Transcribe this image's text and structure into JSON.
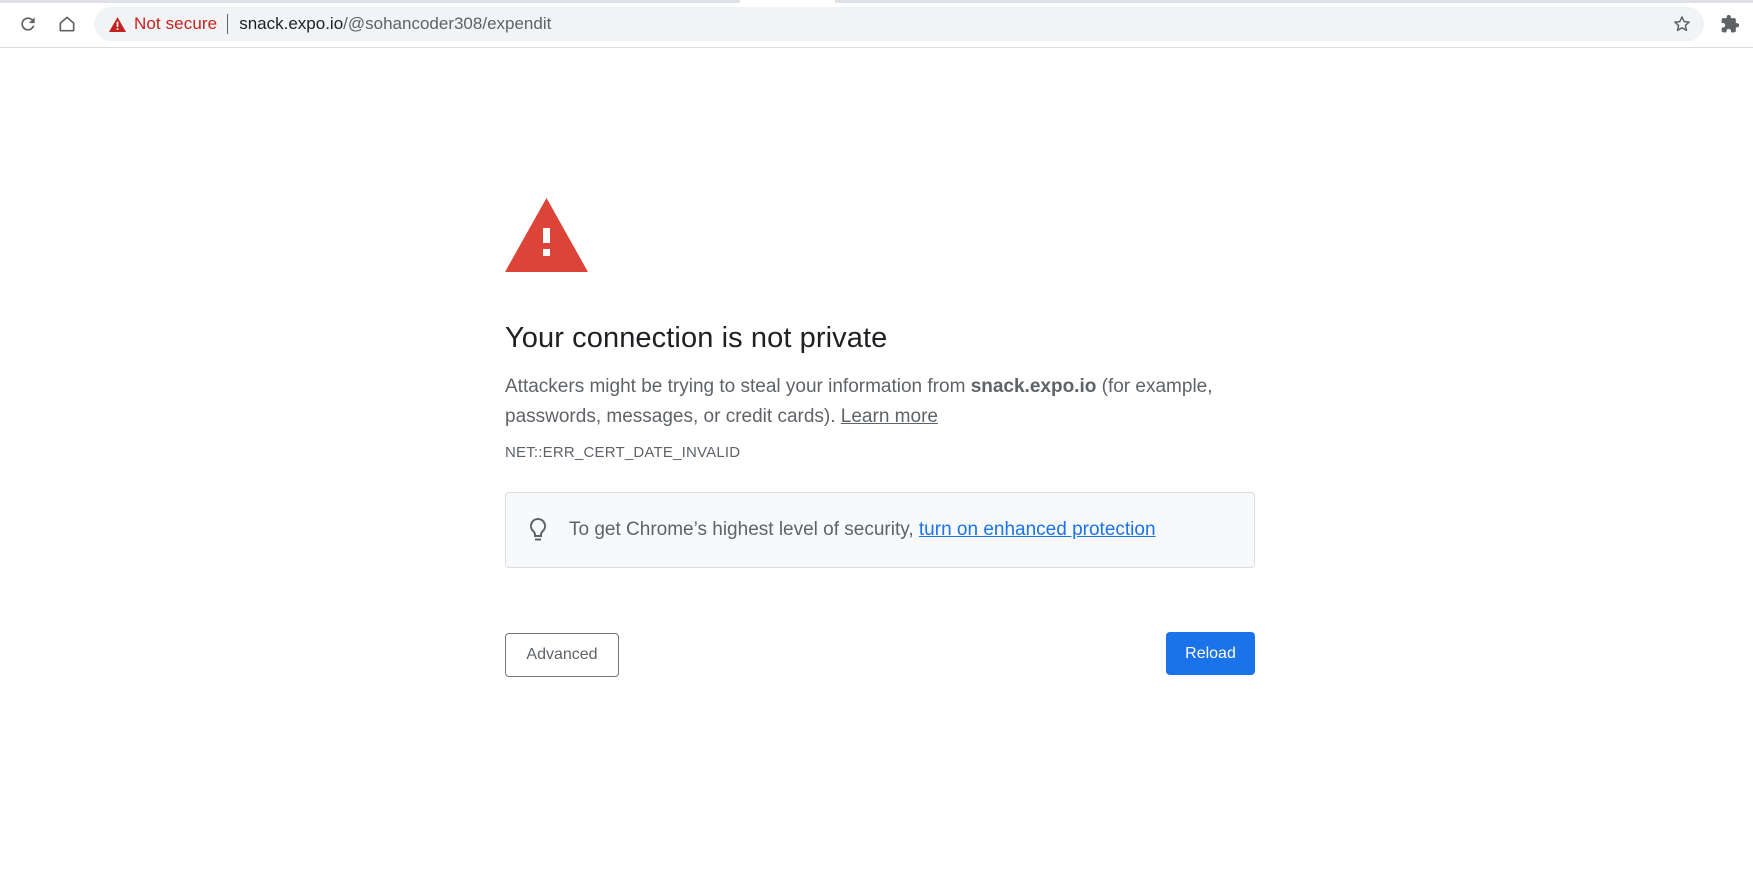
{
  "browser": {
    "toolbar": {
      "reload_icon": "reload-icon",
      "home_icon": "home-icon",
      "bookmark_icon": "star-icon",
      "extensions_icon": "puzzle-piece-icon"
    },
    "omnibox": {
      "security_icon": "warning-triangle-icon",
      "security_label": "Not secure",
      "url_host": "snack.expo.io",
      "url_path": "/@sohancoder308/expendit"
    }
  },
  "interstitial": {
    "icon": "red-warning-triangle-icon",
    "title": "Your connection is not private",
    "description_prefix": "Attackers might be trying to steal your information from ",
    "description_host": "snack.expo.io",
    "description_suffix": " (for example, passwords, messages, or credit cards). ",
    "learn_more": "Learn more",
    "error_code": "NET::ERR_CERT_DATE_INVALID",
    "enhanced_protection": {
      "icon": "lightbulb-icon",
      "text": "To get Chrome’s highest level of security, ",
      "link": "turn on enhanced protection"
    },
    "buttons": {
      "advanced": "Advanced",
      "reload": "Reload"
    }
  },
  "colors": {
    "danger_red": "#db4437",
    "not_secure_text": "#c5221f",
    "link_blue": "#1a73e8",
    "primary_button": "#1a73e8"
  }
}
